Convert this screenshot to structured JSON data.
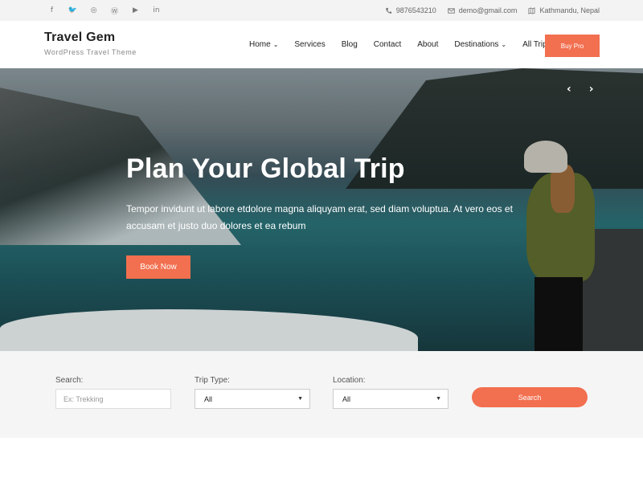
{
  "topbar": {
    "social": [
      {
        "icon": "facebook-icon",
        "glyph": "f"
      },
      {
        "icon": "twitter-icon",
        "glyph": "🐦"
      },
      {
        "icon": "instagram-icon",
        "glyph": "◎"
      },
      {
        "icon": "wordpress-icon",
        "glyph": "Ⓦ"
      },
      {
        "icon": "youtube-icon",
        "glyph": "▶"
      },
      {
        "icon": "linkedin-icon",
        "glyph": "in"
      }
    ],
    "phone": "9876543210",
    "email": "demo@gmail.com",
    "location": "Kathmandu, Nepal"
  },
  "header": {
    "site_title": "Travel Gem",
    "tagline": "WordPress Travel Theme",
    "nav": [
      {
        "label": "Home",
        "dropdown": true
      },
      {
        "label": "Services",
        "dropdown": false
      },
      {
        "label": "Blog",
        "dropdown": false
      },
      {
        "label": "Contact",
        "dropdown": false
      },
      {
        "label": "About",
        "dropdown": false
      },
      {
        "label": "Destinations",
        "dropdown": true
      },
      {
        "label": "All Trips",
        "dropdown": false
      }
    ],
    "buy_label": "Buy Pro"
  },
  "hero": {
    "title": "Plan Your Global Trip",
    "text": "Tempor invidunt ut labore etdolore magna aliquyam erat, sed diam voluptua. At vero eos et accusam et justo duo dolores et ea rebum",
    "button": "Book Now",
    "prev_glyph": "‹",
    "next_glyph": "›"
  },
  "search": {
    "search_label": "Search:",
    "search_placeholder": "Ex: Trekking",
    "trip_type_label": "Trip Type:",
    "trip_type_value": "All",
    "location_label": "Location:",
    "location_value": "All",
    "button": "Search"
  },
  "colors": {
    "accent": "#f26f4f",
    "topbar_bg": "#f3f3f3",
    "search_bg": "#f5f5f5"
  }
}
